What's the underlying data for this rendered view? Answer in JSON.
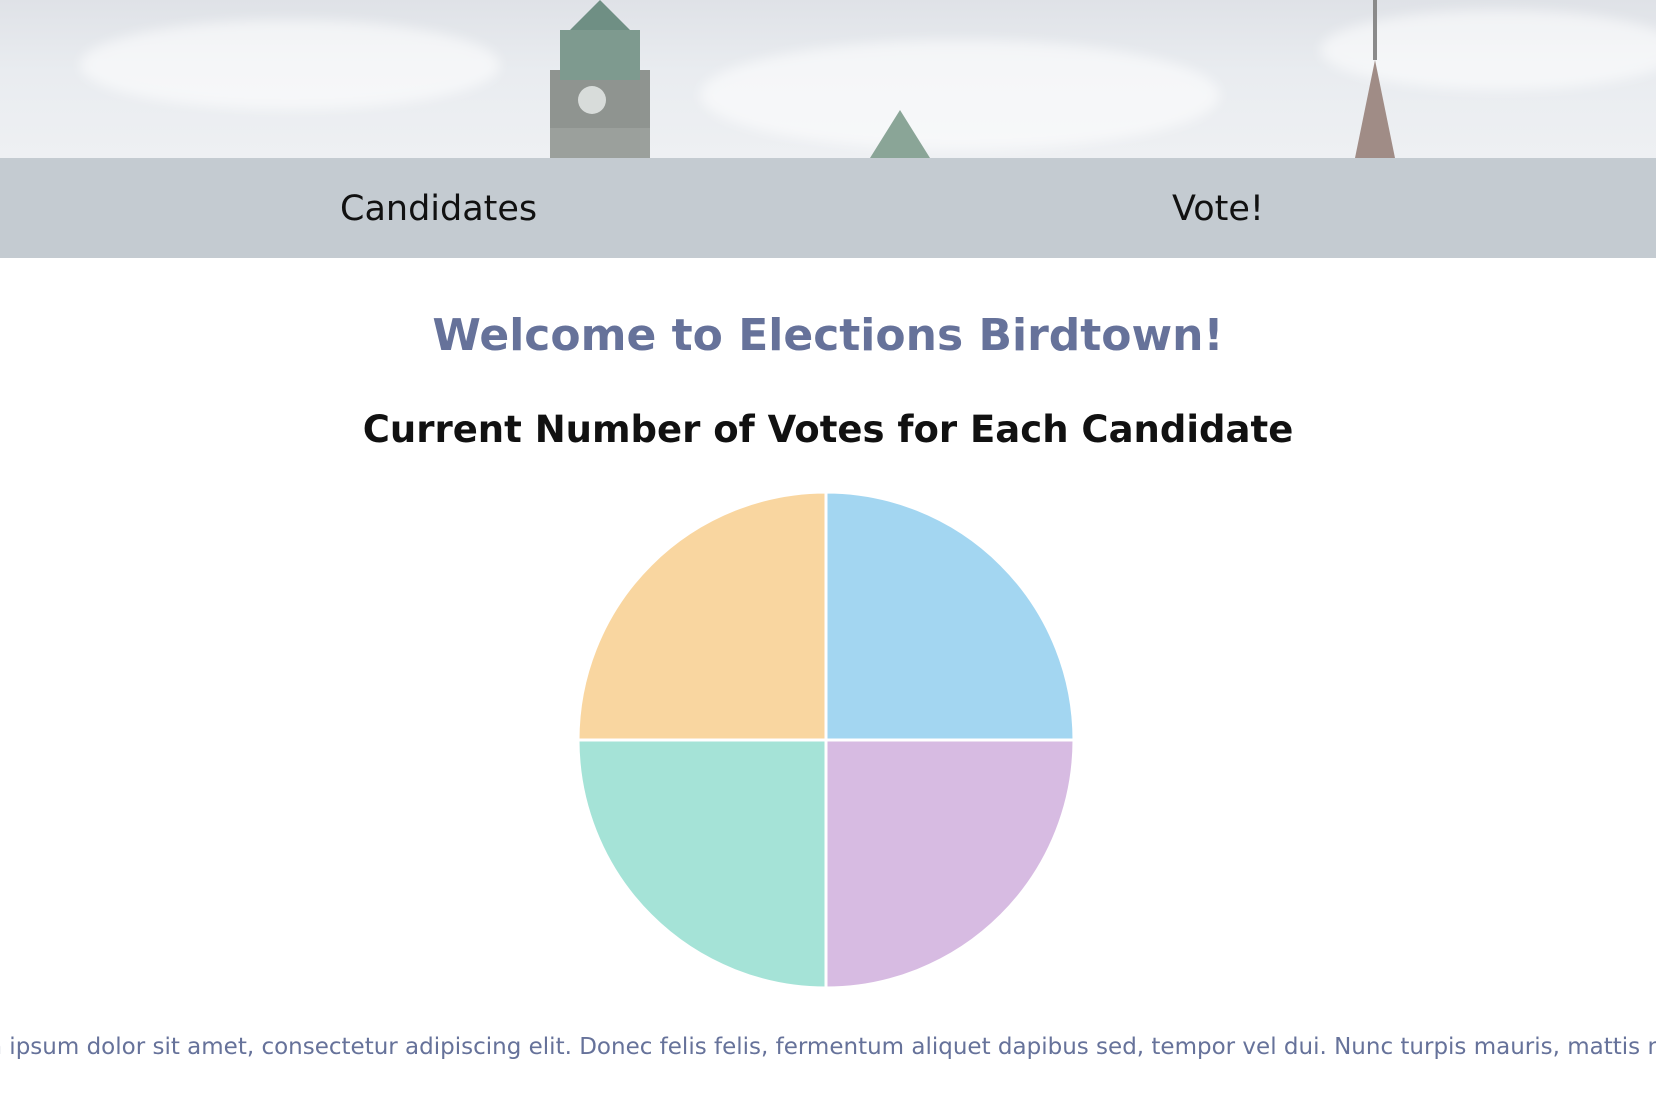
{
  "nav": {
    "items": [
      {
        "label": "Candidates"
      },
      {
        "label": "Vote!"
      }
    ]
  },
  "main": {
    "headline": "Welcome to Elections Birdtown!",
    "chart_title": "Current Number of Votes for Each Candidate",
    "paragraph": "Lorem ipsum dolor sit amet, consectetur adipiscing elit. Donec felis felis, fermentum aliquet dapibus sed, tempor vel dui. Nunc turpis mauris, mattis nec volutpat sed, vulputate"
  },
  "colors": {
    "nav_bg": "#c4cbd1",
    "headline": "#66729a",
    "slice_blue": "#a3d6f1",
    "slice_purple": "#d7bbe2",
    "slice_teal": "#a5e3d7",
    "slice_orange": "#f9d6a0"
  },
  "chart_data": {
    "type": "pie",
    "title": "Current Number of Votes for Each Candidate",
    "values": [
      1,
      1,
      1,
      1
    ],
    "colors": [
      "#a3d6f1",
      "#d7bbe2",
      "#a5e3d7",
      "#f9d6a0"
    ]
  }
}
